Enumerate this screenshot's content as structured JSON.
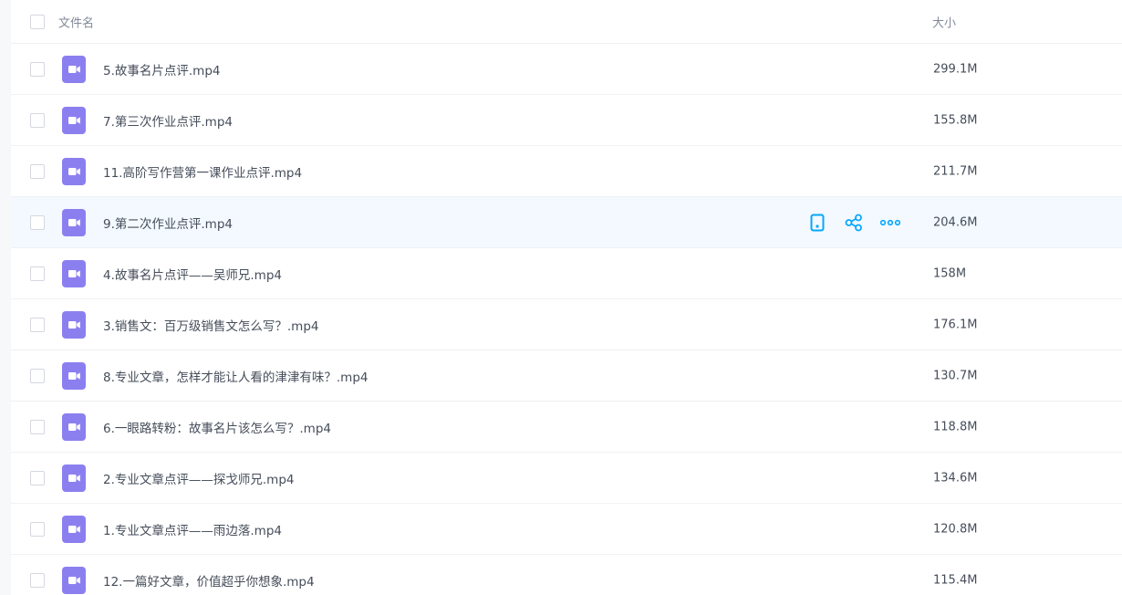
{
  "header": {
    "name_label": "文件名",
    "size_label": "大小"
  },
  "colors": {
    "accent": "#06a7ff",
    "file_icon": "#8b7ff0",
    "hover_row": "#f3f9fe"
  },
  "hover_actions": [
    {
      "icon": "phone-icon"
    },
    {
      "icon": "share-icon"
    },
    {
      "icon": "more-icon"
    }
  ],
  "files": [
    {
      "name": "5.故事名片点评.mp4",
      "size": "299.1M",
      "icon": "video-file-icon"
    },
    {
      "name": "7.第三次作业点评.mp4",
      "size": "155.8M",
      "icon": "video-file-icon"
    },
    {
      "name": "11.高阶写作营第一课作业点评.mp4",
      "size": "211.7M",
      "icon": "video-file-icon"
    },
    {
      "name": "9.第二次作业点评.mp4",
      "size": "204.6M",
      "icon": "video-file-icon",
      "hovered": true
    },
    {
      "name": "4.故事名片点评——吴师兄.mp4",
      "size": "158M",
      "icon": "video-file-icon"
    },
    {
      "name": "3.销售文：百万级销售文怎么写？.mp4",
      "size": "176.1M",
      "icon": "video-file-icon"
    },
    {
      "name": "8.专业文章，怎样才能让人看的津津有味？.mp4",
      "size": "130.7M",
      "icon": "video-file-icon"
    },
    {
      "name": "6.一眼路转粉：故事名片该怎么写？.mp4",
      "size": "118.8M",
      "icon": "video-file-icon"
    },
    {
      "name": "2.专业文章点评——探戈师兄.mp4",
      "size": "134.6M",
      "icon": "video-file-icon"
    },
    {
      "name": "1.专业文章点评——雨边落.mp4",
      "size": "120.8M",
      "icon": "video-file-icon"
    },
    {
      "name": "12.一篇好文章，价值超乎你想象.mp4",
      "size": "115.4M",
      "icon": "video-file-icon"
    }
  ]
}
